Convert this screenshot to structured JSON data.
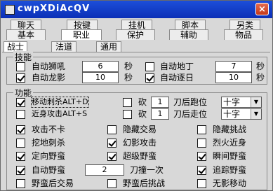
{
  "window": {
    "title": "cwpXDiAcQV",
    "close_label": "×"
  },
  "top_tabs_row1": [
    "聊天",
    "按键",
    "挂机",
    "脚本",
    "另类"
  ],
  "top_tabs_row2": [
    "基本",
    "职业",
    "保护",
    "辅助",
    "物品"
  ],
  "sub_tabs": [
    "战士",
    "法道",
    "通用"
  ],
  "skills": {
    "group_label": "技能",
    "items": [
      {
        "label": "自动狮吼",
        "checked": false,
        "value": "6",
        "unit": "秒"
      },
      {
        "label": "自动地丁",
        "checked": false,
        "value": "7",
        "unit": "秒"
      },
      {
        "label": "自动龙影",
        "checked": true,
        "value": "10",
        "unit": "秒"
      },
      {
        "label": "自动逐日",
        "checked": true,
        "value": "10",
        "unit": "秒"
      }
    ]
  },
  "functions": {
    "group_label": "功能",
    "row1": {
      "label": "移动刺杀ALT+D",
      "checked": true,
      "chop_label": "砍",
      "chop_checked": false,
      "chop_value": "1",
      "after_label": "刀后跑位",
      "select_value": "十字"
    },
    "row2": {
      "label": "近身攻击ALT+S",
      "checked": false,
      "chop_label": "砍",
      "chop_checked": false,
      "chop_value": "1",
      "after_label": "刀后走位",
      "select_value": "十字"
    },
    "grid": [
      {
        "label": "攻击不卡",
        "checked": true
      },
      {
        "label": "隐藏交易",
        "checked": false
      },
      {
        "label": "隐藏挑战",
        "checked": false
      },
      {
        "label": "挖地刺杀",
        "checked": false
      },
      {
        "label": "幻影攻击",
        "checked": true
      },
      {
        "label": "烈火近身",
        "checked": false
      },
      {
        "label": "定向野蛮",
        "checked": true
      },
      {
        "label": "超级野蛮",
        "checked": true
      },
      {
        "label": "瞬间野蛮",
        "checked": true
      }
    ],
    "auto_savage": {
      "label": "自动野蛮",
      "checked": true,
      "value": "2",
      "suffix": "刀撞一次"
    },
    "chase": {
      "label": "追踪野蛮",
      "checked": true
    },
    "bottom": [
      {
        "label": "野蛮后交易",
        "checked": false
      },
      {
        "label": "野蛮后挑战",
        "checked": false
      },
      {
        "label": "无影移动",
        "checked": false
      }
    ]
  }
}
